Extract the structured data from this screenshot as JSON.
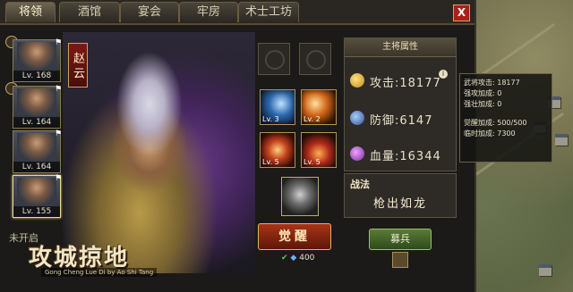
{
  "tabs": [
    "将领",
    "酒馆",
    "宴会",
    "牢房",
    "术士工坊"
  ],
  "close_label": "X",
  "heroes": [
    {
      "level": "Lv. 168"
    },
    {
      "level": "Lv. 164"
    },
    {
      "level": "Lv. 164"
    },
    {
      "level": "Lv. 155"
    }
  ],
  "unopened_label": "未开启",
  "hero_name": "赵云",
  "logo": {
    "title": "攻城掠地",
    "subtitle": "Gong Cheng Lue Di by Ao Shi Tang"
  },
  "skills": [
    {
      "level": "Lv. 3"
    },
    {
      "level": "Lv. 2"
    },
    {
      "level": "Lv. 5"
    },
    {
      "level": "Lv. 5"
    }
  ],
  "awaken_label": "觉醒",
  "awaken_cost": "400",
  "stats_panel": {
    "header": "主将属性",
    "attack": "攻击:18177",
    "defense": "防御:6147",
    "hp": "血量:16344"
  },
  "info_icon_label": "i",
  "tactics": {
    "label": "战法",
    "value": "枪出如龙"
  },
  "recruit_label": "募兵",
  "tooltip": {
    "line1": "武将攻击: 18177",
    "line2": "强攻加成: 0",
    "line3": "强壮加成: 0",
    "line4": "觉醒加成: 500/500",
    "line5": "临时加成: 7300"
  },
  "colors": {
    "accent_red": "#a8201a",
    "gold_border": "#d4a050",
    "green_button": "#5a7a3a"
  }
}
